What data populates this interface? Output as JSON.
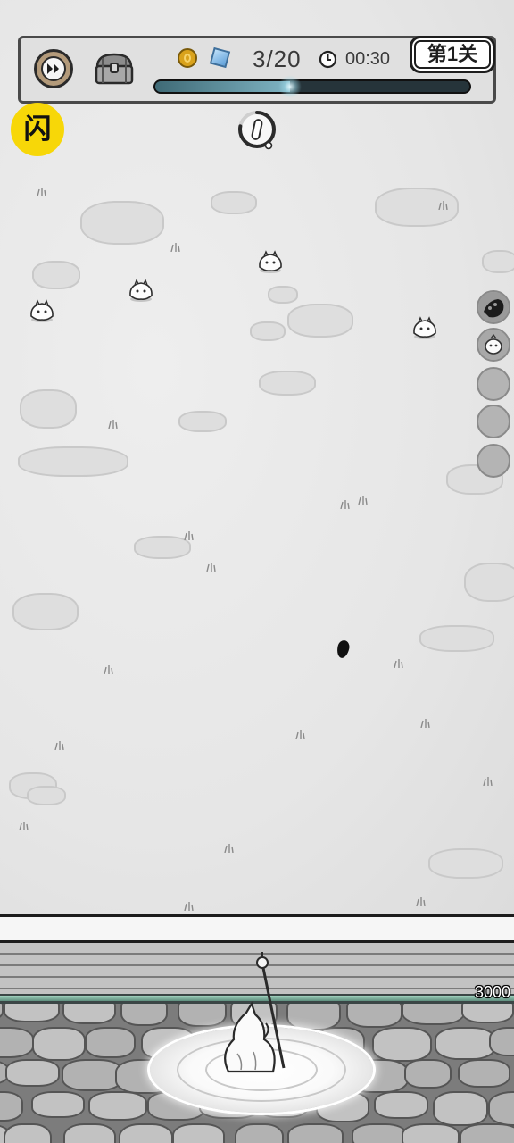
{
  "hud": {
    "fast_forward_icon": "fast-forward-icon",
    "chest_icon": "treasure-chest-icon",
    "coin_icon": "gold-coin-icon",
    "gem_icon": "blue-gem-icon",
    "wave": "3/20",
    "clock_icon": "clock-icon",
    "time": "00:30",
    "level": "第1关",
    "wave_progress": 0.43
  },
  "flash_button": {
    "label": "闪"
  },
  "cooldown": {
    "icon": "pill-icon",
    "fill": 0.78
  },
  "skills": [
    {
      "icon": "shadow-skill-icon",
      "equipped": true
    },
    {
      "icon": "blob-skill-icon",
      "equipped": true
    },
    {
      "icon": "empty-slot",
      "equipped": false
    },
    {
      "icon": "empty-slot",
      "equipped": false
    },
    {
      "icon": "empty-slot",
      "equipped": false
    }
  ],
  "enemy_icon": "white-blob-enemy",
  "projectile_icon": "black-teardrop-projectile",
  "hero_icon": "hooded-mage-with-staff",
  "base": {
    "hp": "3000",
    "hp_fraction": 1.0
  },
  "colors": {
    "flash_yellow": "#f7d708",
    "wave_bar": "#7fb4c3",
    "hp_bar": "#9fd0bd",
    "gem_blue": "#5e9fd8",
    "coin_gold": "#d9a21c"
  }
}
